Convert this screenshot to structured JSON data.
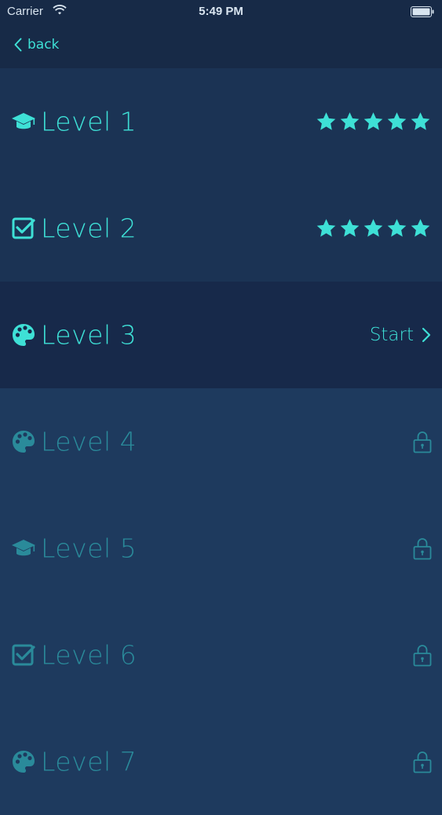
{
  "status_bar": {
    "carrier": "Carrier",
    "time": "5:49 PM"
  },
  "nav": {
    "back_label": "back"
  },
  "colors": {
    "accent": "#3ee0d6",
    "locked": "#2a8a9a",
    "background": "#1e3a5e"
  },
  "levels": [
    {
      "label": "Level 1",
      "icon": "graduation-cap-icon",
      "state": "completed",
      "stars": 5
    },
    {
      "label": "Level 2",
      "icon": "checkbox-icon",
      "state": "completed",
      "stars": 5
    },
    {
      "label": "Level 3",
      "icon": "palette-icon",
      "state": "current",
      "action_label": "Start"
    },
    {
      "label": "Level 4",
      "icon": "palette-icon",
      "state": "locked"
    },
    {
      "label": "Level 5",
      "icon": "graduation-cap-icon",
      "state": "locked"
    },
    {
      "label": "Level 6",
      "icon": "checkbox-icon",
      "state": "locked"
    },
    {
      "label": "Level 7",
      "icon": "palette-icon",
      "state": "locked"
    }
  ]
}
